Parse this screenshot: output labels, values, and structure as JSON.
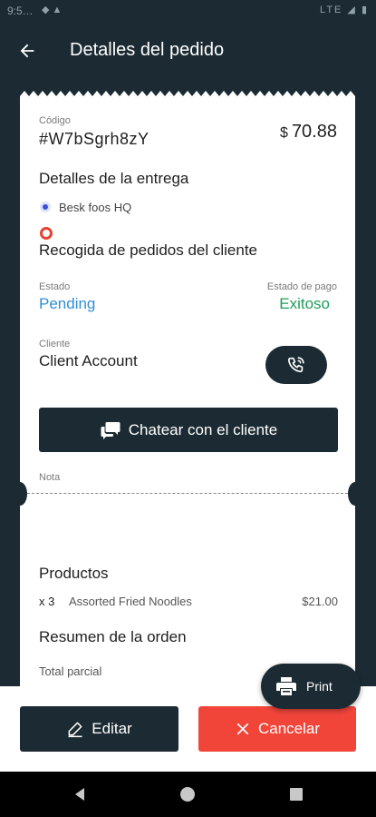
{
  "status_bar": {
    "time": "9:5…",
    "left_icons": "◆ ▲",
    "right_icons": "LTE ◢ ▮"
  },
  "header": {
    "title": "Detalles del pedido"
  },
  "order": {
    "code_label": "Código",
    "code": "#W7bSgrh8zY",
    "currency": "$",
    "amount": "70.88"
  },
  "delivery": {
    "title": "Detalles de la entrega",
    "pickup": "Besk foos HQ",
    "dropoff": "Recogida de pedidos del cliente"
  },
  "status": {
    "estado_label": "Estado",
    "estado_value": "Pending",
    "pago_label": "Estado de pago",
    "pago_value": "Exitoso"
  },
  "client": {
    "label": "Cliente",
    "name": "Client Account"
  },
  "chat_button": {
    "label": "Chatear con el cliente"
  },
  "note": {
    "label": "Nota"
  },
  "products": {
    "title": "Productos",
    "items": [
      {
        "qty": "x 3",
        "name": "Assorted Fried Noodles",
        "price": "$21.00"
      }
    ]
  },
  "summary": {
    "title": "Resumen de la orden",
    "subtotal_label": "Total parcial"
  },
  "print_button": {
    "label": "Print"
  },
  "actions": {
    "edit_label": "Editar",
    "cancel_label": "Cancelar"
  },
  "colors": {
    "primary": "#1c2b33",
    "danger": "#f2453a",
    "status_blue": "#2f8fd6",
    "success_green": "#1e9c5a",
    "pickup_blue": "#3d4fd8",
    "dropoff_red": "#e8412f"
  }
}
